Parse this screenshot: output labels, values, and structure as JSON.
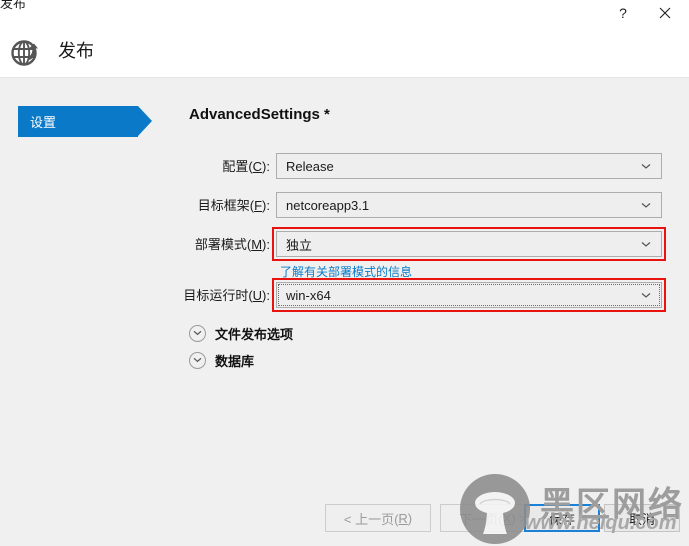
{
  "window": {
    "title": "发布",
    "help_icon": "question-mark-icon",
    "close_icon": "close-icon"
  },
  "header": {
    "icon": "publish-globe-icon",
    "title": "发布"
  },
  "sidebar": {
    "items": [
      {
        "label": "设置",
        "selected": true
      }
    ]
  },
  "main": {
    "page_title": "AdvancedSettings *",
    "fields": [
      {
        "label_prefix": "配置(",
        "accel": "C",
        "label_suffix": "):",
        "value": "Release",
        "highlighted": false,
        "focused": false
      },
      {
        "label_prefix": "目标框架(",
        "accel": "F",
        "label_suffix": "):",
        "value": "netcoreapp3.1",
        "highlighted": false,
        "focused": false
      },
      {
        "label_prefix": "部署模式(",
        "accel": "M",
        "label_suffix": "):",
        "value": "独立",
        "highlighted": true,
        "focused": false
      },
      {
        "label_prefix": "目标运行时(",
        "accel": "U",
        "label_suffix": "):",
        "value": "win-x64",
        "highlighted": true,
        "focused": true
      }
    ],
    "hint_link": "了解有关部署模式的信息",
    "expanders": [
      {
        "label": "文件发布选项",
        "icon": "chevron-down-circle-icon"
      },
      {
        "label": "数据库",
        "icon": "chevron-down-circle-icon"
      }
    ]
  },
  "footer": {
    "buttons": [
      {
        "name": "prev",
        "prefix": "< 上一页(",
        "accel": "R",
        "suffix": ")",
        "disabled": true,
        "focus": false
      },
      {
        "name": "next",
        "prefix": "下一页(",
        "accel": "X",
        "suffix": ") >",
        "disabled": true,
        "focus": false
      },
      {
        "name": "save",
        "prefix": "保存",
        "accel": "",
        "suffix": "",
        "disabled": false,
        "focus": true
      },
      {
        "name": "cancel",
        "prefix": "取消",
        "accel": "",
        "suffix": "",
        "disabled": false,
        "focus": false
      }
    ]
  },
  "watermark": {
    "brand_cn": "黑区网络",
    "url": "www.heiqu.com",
    "logo_icon": "mushroom-logo-icon"
  },
  "colors": {
    "accent_blue": "#0a7ac8",
    "annotation_red": "#e8120f",
    "focus_blue": "#1a81d6",
    "body_bg": "#f0f0f0",
    "field_bg": "#eeeeee"
  }
}
